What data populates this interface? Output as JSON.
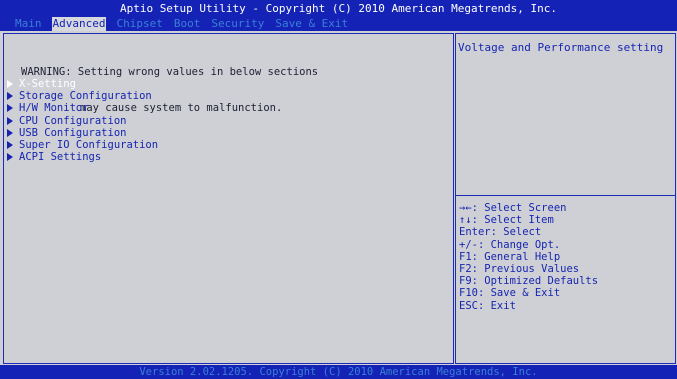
{
  "header": {
    "title": "Aptio Setup Utility - Copyright (C) 2010 American Megatrends, Inc.",
    "tabs": [
      {
        "label": "Main"
      },
      {
        "label": "Advanced"
      },
      {
        "label": "Chipset"
      },
      {
        "label": "Boot"
      },
      {
        "label": "Security"
      },
      {
        "label": "Save & Exit"
      }
    ],
    "active_tab": "Advanced"
  },
  "left": {
    "warning_line1": "WARNING: Setting wrong values in below sections",
    "warning_line2": "may cause system to malfunction.",
    "menu": [
      {
        "label": "X-Setting"
      },
      {
        "label": "Storage Configuration"
      },
      {
        "label": "H/W Monitor"
      },
      {
        "label": "CPU Configuration"
      },
      {
        "label": "USB Configuration"
      },
      {
        "label": "Super IO Configuration"
      },
      {
        "label": "ACPI Settings"
      }
    ],
    "selected_item": "X-Setting"
  },
  "right": {
    "help_text": "Voltage and Performance setting",
    "keys": [
      "→←: Select Screen",
      "↑↓: Select Item",
      "Enter: Select",
      "+/-: Change Opt.",
      "F1: General Help",
      "F2: Previous Values",
      "F9: Optimized Defaults",
      "F10: Save & Exit",
      "ESC: Exit"
    ]
  },
  "footer": {
    "version": "Version 2.02.1205. Copyright (C) 2010 American Megatrends, Inc."
  },
  "colors": {
    "bar_blue": "#1423b5",
    "panel_gray": "#cfd0d6",
    "menu_blue": "#1525b0",
    "selected_white": "#ffffff",
    "inactive_tab_blue": "#3b7fd8"
  }
}
